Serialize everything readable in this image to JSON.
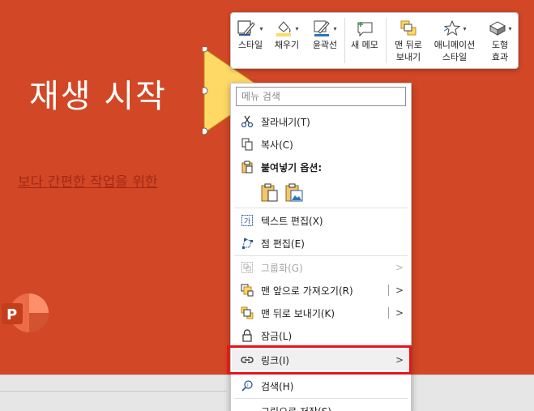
{
  "slide": {
    "title": "재생 시작",
    "subtitle": "보다 간편한 작업을 위한 ",
    "bg_color": "#d24726",
    "shape_color": "#ffd966"
  },
  "app_logo": {
    "letter": "P",
    "icon": "powerpoint-logo-icon"
  },
  "mini_toolbar": {
    "buttons": [
      {
        "label": "스타일",
        "icon": "shape-style-icon"
      },
      {
        "label": "채우기",
        "icon": "fill-bucket-icon"
      },
      {
        "label": "윤곽선",
        "icon": "outline-pen-icon"
      },
      {
        "label": "새 메모",
        "icon": "new-comment-icon"
      },
      {
        "label_line1": "맨 뒤로",
        "label_line2": "보내기",
        "icon": "send-to-back-icon"
      },
      {
        "label_line1": "애니메이션",
        "label_line2": "스타일",
        "icon": "animation-star-icon"
      },
      {
        "label_line1": "도형",
        "label_line2": "효과",
        "icon": "shape-effects-icon"
      }
    ]
  },
  "context_menu": {
    "search_placeholder": "메뉴 검색",
    "items": {
      "cut": "잘라내기(T)",
      "copy": "복사(C)",
      "paste_options": "붙여넣기 옵션:",
      "edit_text": "텍스트 편집(X)",
      "edit_points": "점 편집(E)",
      "group": "그룹화(G)",
      "bring_front": "맨 앞으로 가져오기(R)",
      "send_back": "맨 뒤로 보내기(K)",
      "lock": "잠금(L)",
      "link": "링크(I)",
      "search": "검색(H)",
      "save_picture": "그림으로 저장(S)..."
    }
  },
  "colors": {
    "accent_red": "#e8141b",
    "menu_icon_blue": "#2b5797"
  }
}
